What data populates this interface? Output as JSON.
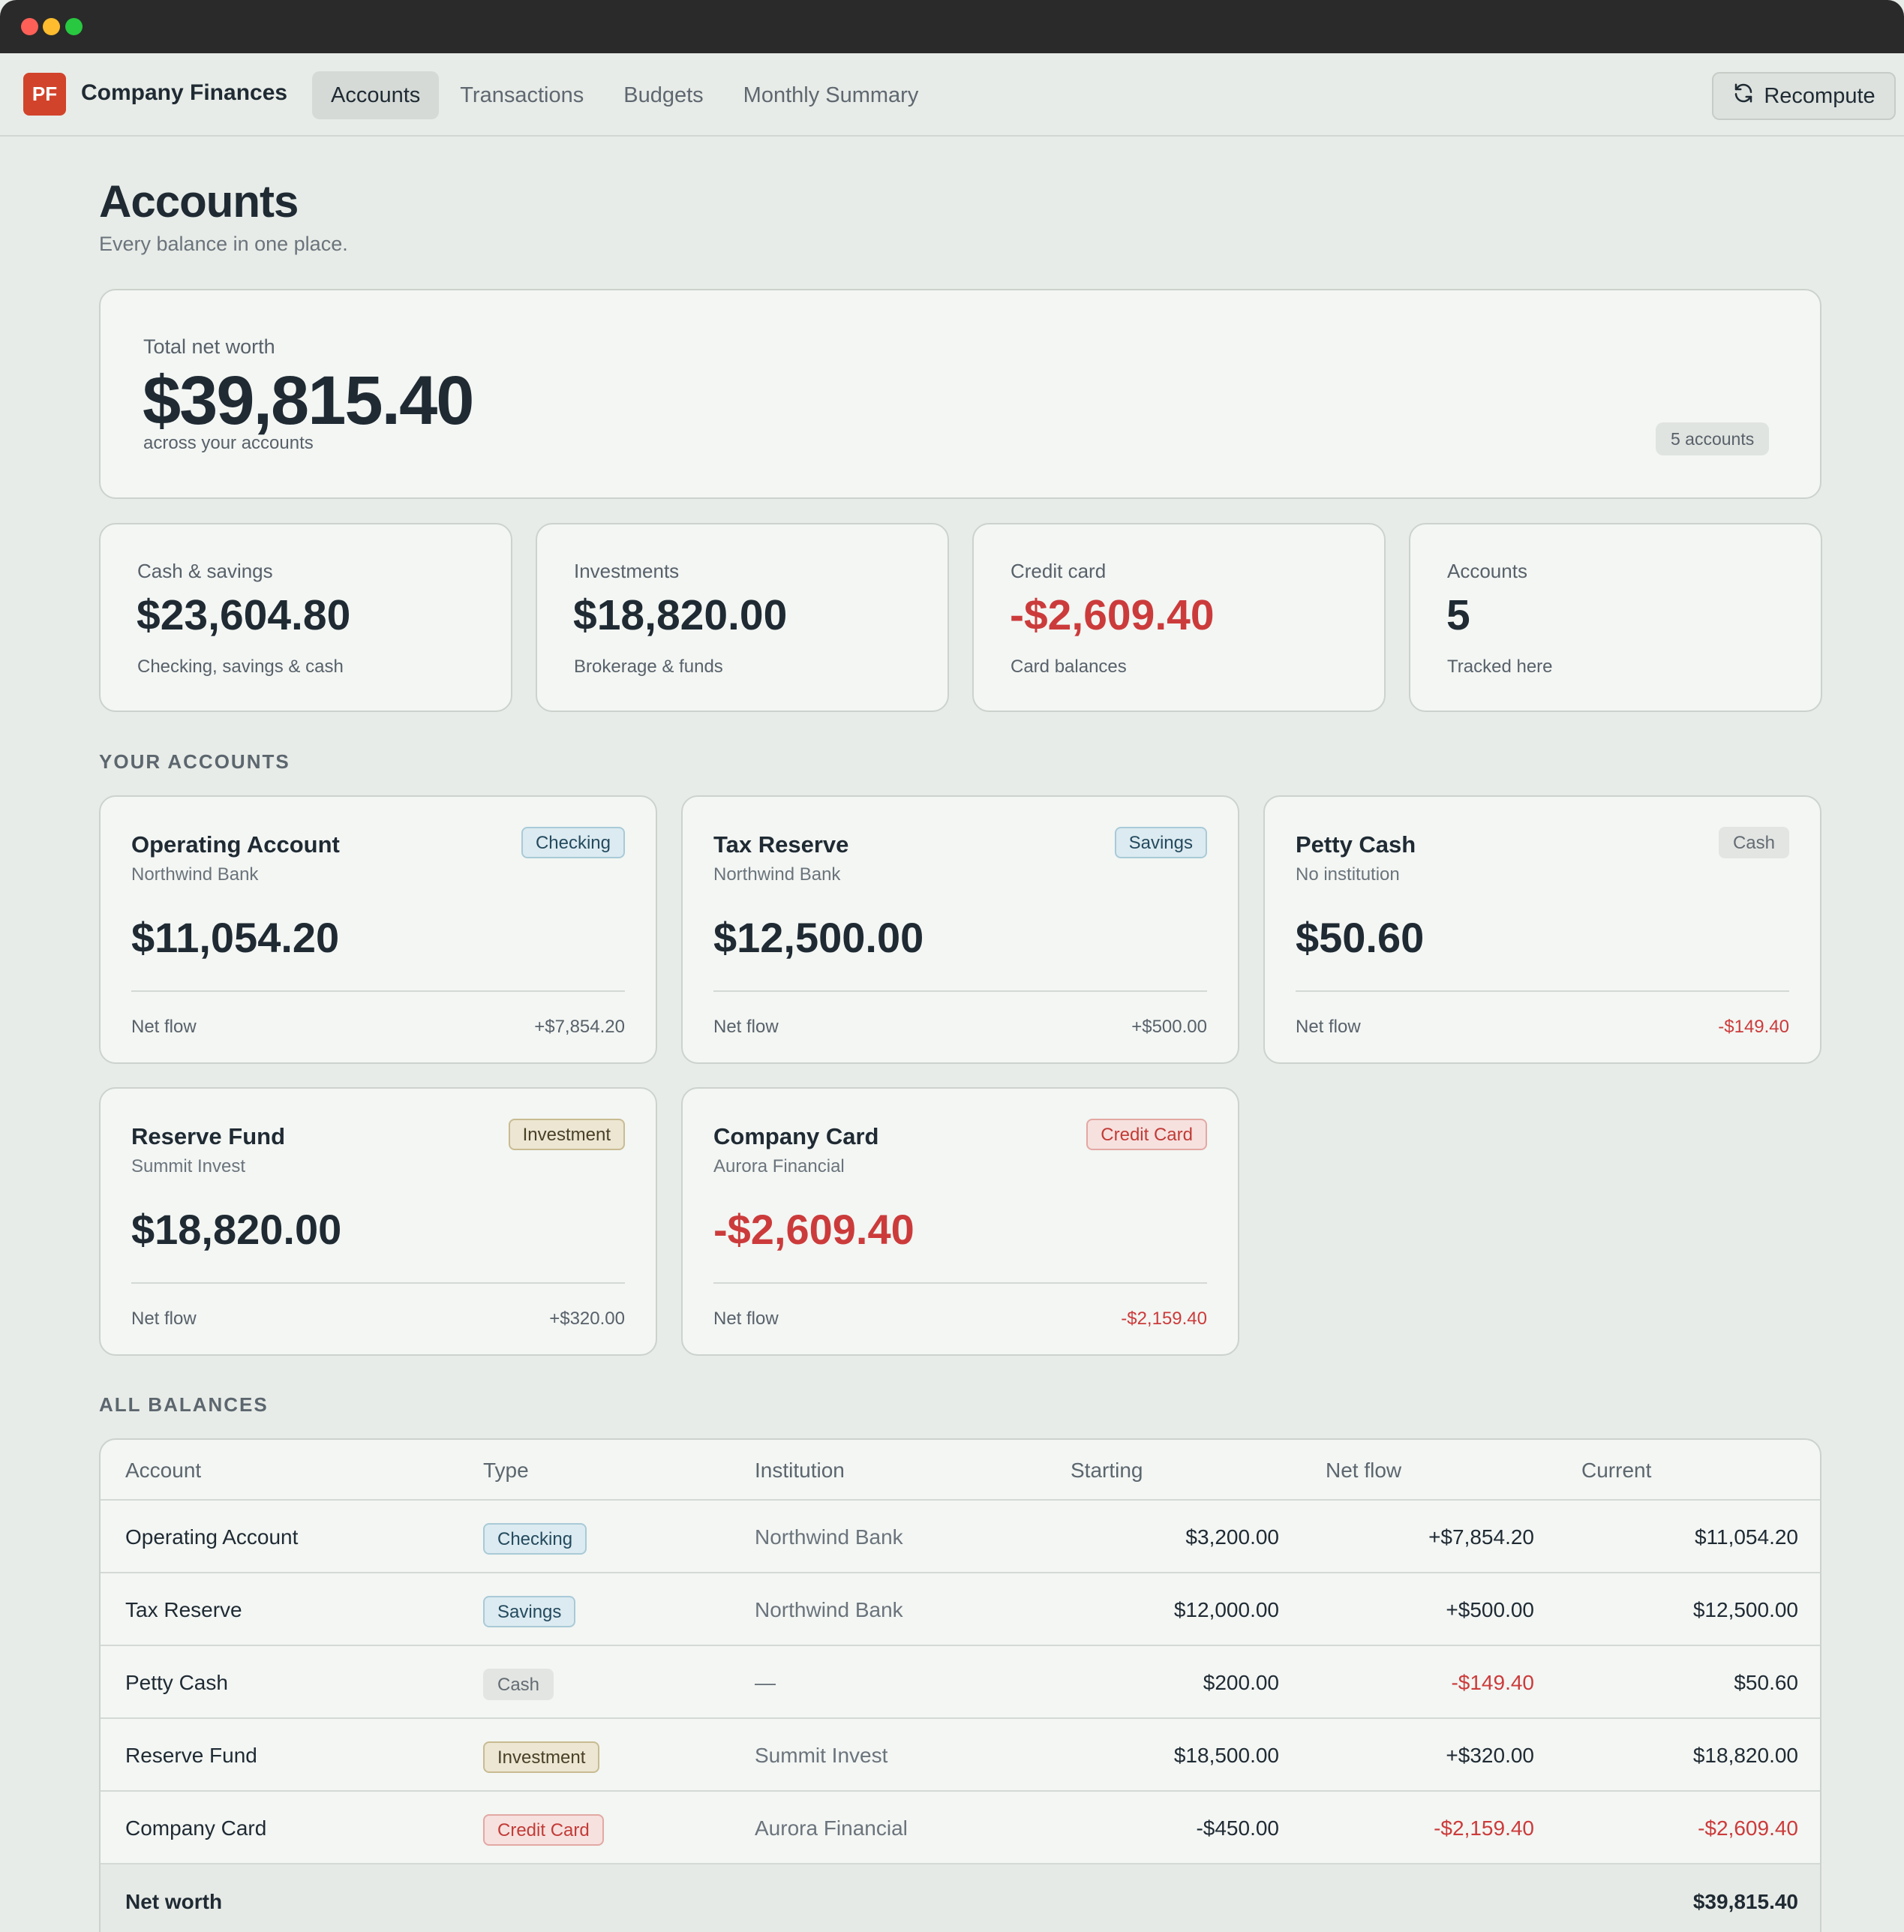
{
  "app": {
    "logo_text": "PF",
    "name": "Company Finances"
  },
  "nav": {
    "tabs": [
      {
        "label": "Accounts",
        "active": true
      },
      {
        "label": "Transactions",
        "active": false
      },
      {
        "label": "Budgets",
        "active": false
      },
      {
        "label": "Monthly Summary",
        "active": false
      }
    ],
    "recompute_label": "Recompute"
  },
  "page": {
    "title": "Accounts",
    "subtitle": "Every balance in one place."
  },
  "hero": {
    "label": "Total net worth",
    "value": "$39,815.40",
    "sub": "across your accounts",
    "badge": "5 accounts"
  },
  "stats": [
    {
      "label": "Cash & savings",
      "value": "$23,604.80",
      "sub": "Checking, savings & cash",
      "negative": false
    },
    {
      "label": "Investments",
      "value": "$18,820.00",
      "sub": "Brokerage & funds",
      "negative": false
    },
    {
      "label": "Credit card",
      "value": "-$2,609.40",
      "sub": "Card balances",
      "negative": true
    },
    {
      "label": "Accounts",
      "value": "5",
      "sub": "Tracked here",
      "negative": false
    }
  ],
  "sections": {
    "your_accounts": "YOUR ACCOUNTS",
    "all_balances": "ALL BALANCES"
  },
  "accounts": [
    {
      "name": "Operating Account",
      "institution": "Northwind Bank",
      "type": "Checking",
      "balance": "$11,054.20",
      "flow_label": "Net flow",
      "flow": "+$7,854.20",
      "negative_balance": false,
      "negative_flow": false
    },
    {
      "name": "Tax Reserve",
      "institution": "Northwind Bank",
      "type": "Savings",
      "balance": "$12,500.00",
      "flow_label": "Net flow",
      "flow": "+$500.00",
      "negative_balance": false,
      "negative_flow": false
    },
    {
      "name": "Petty Cash",
      "institution": "No institution",
      "type": "Cash",
      "balance": "$50.60",
      "flow_label": "Net flow",
      "flow": "-$149.40",
      "negative_balance": false,
      "negative_flow": true
    },
    {
      "name": "Reserve Fund",
      "institution": "Summit Invest",
      "type": "Investment",
      "balance": "$18,820.00",
      "flow_label": "Net flow",
      "flow": "+$320.00",
      "negative_balance": false,
      "negative_flow": false
    },
    {
      "name": "Company Card",
      "institution": "Aurora Financial",
      "type": "Credit Card",
      "balance": "-$2,609.40",
      "flow_label": "Net flow",
      "flow": "-$2,159.40",
      "negative_balance": true,
      "negative_flow": true
    }
  ],
  "table": {
    "headers": [
      "Account",
      "Type",
      "Institution",
      "Starting",
      "Net flow",
      "Current"
    ],
    "rows": [
      {
        "account": "Operating Account",
        "type": "Checking",
        "institution": "Northwind Bank",
        "starting": "$3,200.00",
        "net_flow": "+$7,854.20",
        "current": "$11,054.20"
      },
      {
        "account": "Tax Reserve",
        "type": "Savings",
        "institution": "Northwind Bank",
        "starting": "$12,000.00",
        "net_flow": "+$500.00",
        "current": "$12,500.00"
      },
      {
        "account": "Petty Cash",
        "type": "Cash",
        "institution": "—",
        "starting": "$200.00",
        "net_flow": "-$149.40",
        "current": "$50.60"
      },
      {
        "account": "Reserve Fund",
        "type": "Investment",
        "institution": "Summit Invest",
        "starting": "$18,500.00",
        "net_flow": "+$320.00",
        "current": "$18,820.00"
      },
      {
        "account": "Company Card",
        "type": "Credit Card",
        "institution": "Aurora Financial",
        "starting": "-$450.00",
        "net_flow": "-$2,159.40",
        "current": "-$2,609.40"
      }
    ],
    "footer": {
      "label": "Net worth",
      "value": "$39,815.40"
    }
  },
  "colors": {
    "accent": "#d2432b",
    "negative": "#cc3b3b",
    "background": "#e8ece8",
    "card": "#f3f6f3"
  }
}
